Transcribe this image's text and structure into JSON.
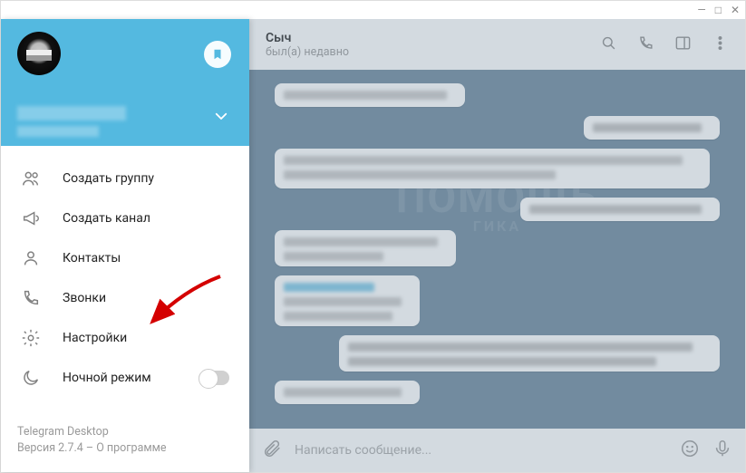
{
  "window": {
    "minimize": "—",
    "maximize": "□",
    "close": "✕"
  },
  "sidebar": {
    "items": [
      {
        "label": "Создать группу",
        "icon": "group-icon"
      },
      {
        "label": "Создать канал",
        "icon": "megaphone-icon"
      },
      {
        "label": "Контакты",
        "icon": "contact-icon"
      },
      {
        "label": "Звонки",
        "icon": "call-icon"
      },
      {
        "label": "Настройки",
        "icon": "gear-icon"
      },
      {
        "label": "Ночной режим",
        "icon": "moon-icon"
      }
    ],
    "footer": {
      "appname": "Telegram Desktop",
      "version_prefix": "Версия 2.7.4 – ",
      "about": "О программе"
    }
  },
  "chat": {
    "title": "Сыч",
    "status": "был(а) недавно",
    "composer_placeholder": "Написать сообщение..."
  },
  "watermark": {
    "line1": "ПОМОЩЬ",
    "line2": "ГИКА"
  }
}
